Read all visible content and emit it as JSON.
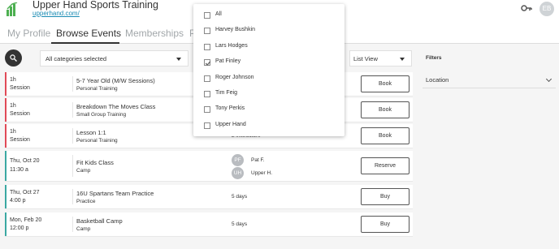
{
  "header": {
    "title": "Upper Hand Sports Training",
    "url": "upperhand.com/",
    "avatar_initials": "EB"
  },
  "tabs": [
    {
      "label": "My Profile",
      "active": false
    },
    {
      "label": "Browse Events",
      "active": true
    },
    {
      "label": "Memberships",
      "active": false
    },
    {
      "label": "P",
      "active": false
    }
  ],
  "toolbar": {
    "category_select": "All categories selected",
    "view_select": "List View"
  },
  "filters": {
    "title": "Filters",
    "location_label": "Location"
  },
  "events": [
    {
      "col1": "1h",
      "col1b": "Session",
      "name": "5-7 Year Old (M/W Sessions)",
      "type": "Personal Training",
      "when": "",
      "button": "Book",
      "accent": "#e04a57"
    },
    {
      "col1": "1h",
      "col1b": "Session",
      "name": "Breakdown The Moves Class",
      "type": "Small Group Training",
      "when": "",
      "button": "Book",
      "accent": "#e04a57"
    },
    {
      "col1": "1h",
      "col1b": "Session",
      "name": "Lesson 1:1",
      "type": "Personal Training",
      "when": "2 instructors",
      "button": "Book",
      "accent": "#e04a57"
    },
    {
      "col1": "Thu, Oct 20",
      "col1b": "11:30 a",
      "name": "Fit Kids Class",
      "type": "Camp",
      "when": "",
      "button": "Reserve",
      "accent": "#3aa8a2",
      "staff": [
        {
          "initials": "PF",
          "name": "Pat F."
        },
        {
          "initials": "UH",
          "name": "Upper H."
        }
      ]
    },
    {
      "col1": "Thu, Oct 27",
      "col1b": "4:00 p",
      "name": "16U Spartans Team Practice",
      "type": "Practice",
      "when": "5 days",
      "button": "Buy",
      "accent": "#3aa8a2"
    },
    {
      "col1": "Mon, Feb 20",
      "col1b": "12:00 p",
      "name": "Basketball Camp",
      "type": "Camp",
      "when": "5 days",
      "button": "Buy",
      "accent": "#3aa8a2"
    }
  ],
  "dropdown": {
    "items": [
      {
        "label": "All",
        "checked": false
      },
      {
        "label": "Harvey Bushkin",
        "checked": false
      },
      {
        "label": "Lars Hodges",
        "checked": false
      },
      {
        "label": "Pat Finley",
        "checked": true
      },
      {
        "label": "Roger Johnson",
        "checked": false
      },
      {
        "label": "Tim Feig",
        "checked": false
      },
      {
        "label": "Tony Perkis",
        "checked": false
      },
      {
        "label": "Upper Hand",
        "checked": false
      }
    ]
  },
  "colors": {
    "session_accent": "#e04a57",
    "dated_accent": "#3aa8a2",
    "brand_green": "#5cb85c",
    "link": "#1a8bb3"
  }
}
